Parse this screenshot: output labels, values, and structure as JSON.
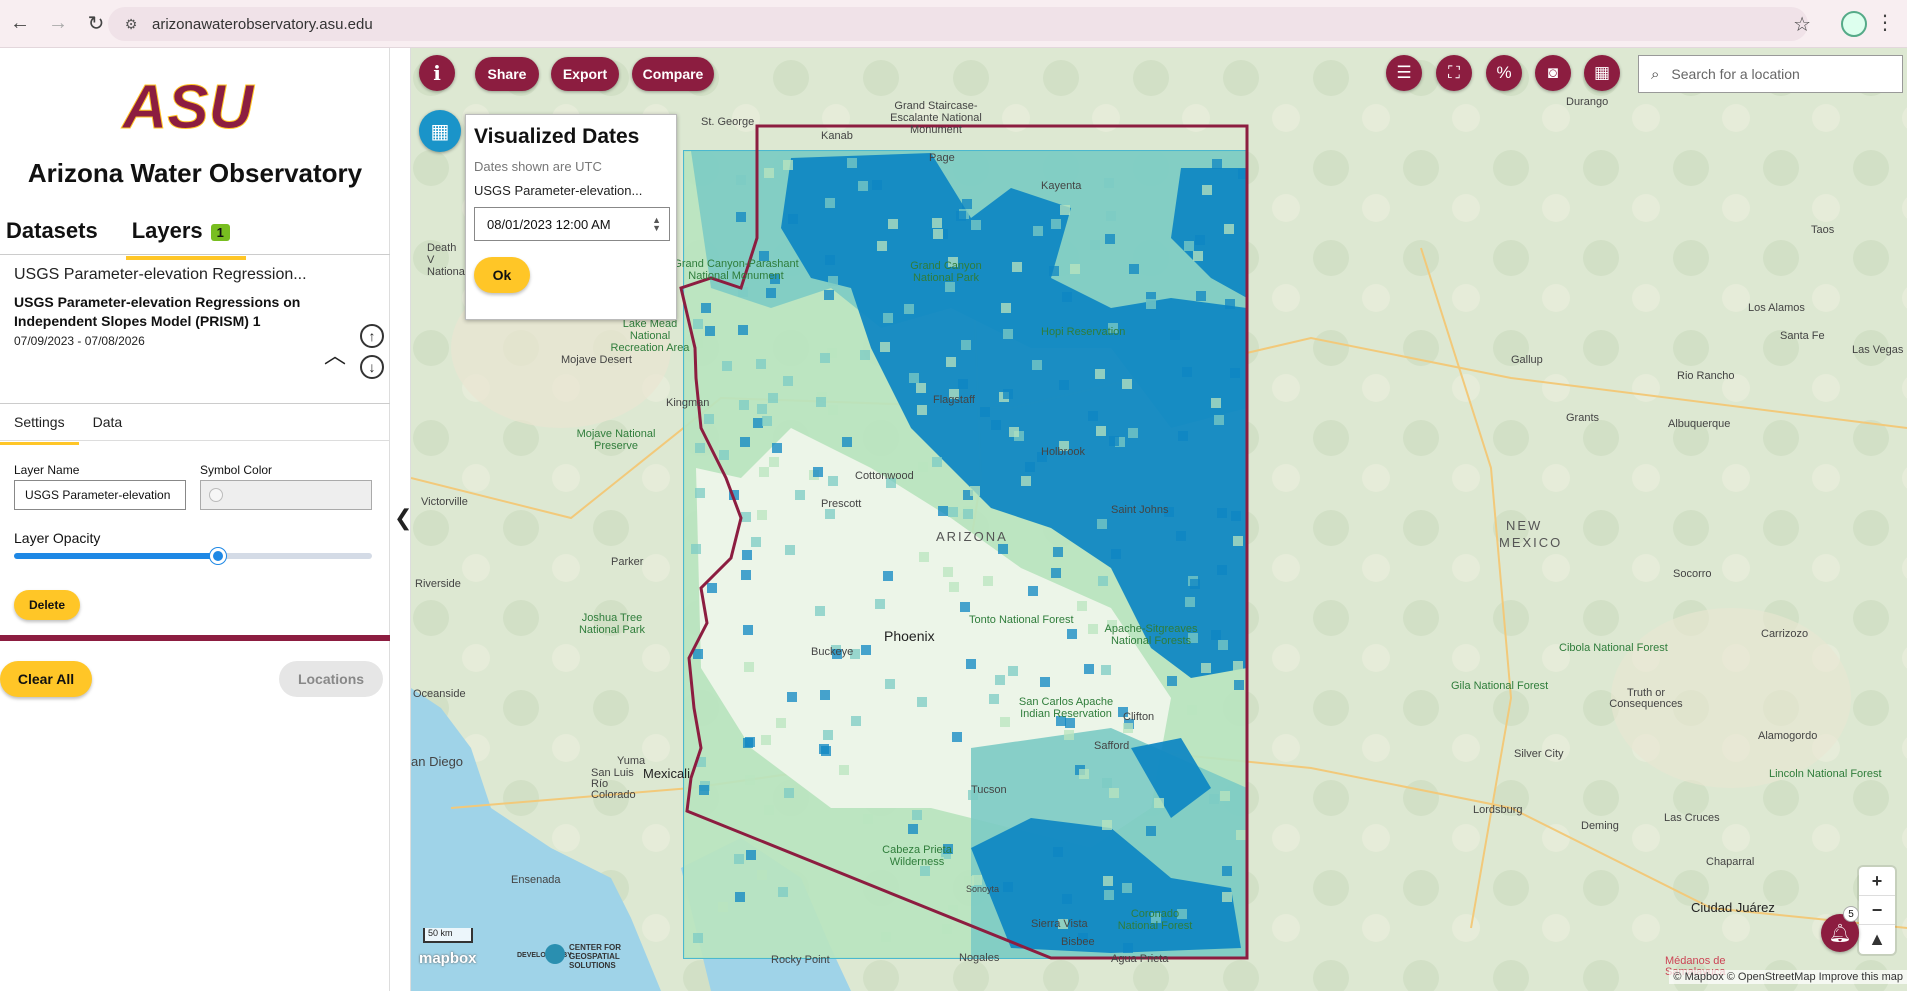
{
  "browser": {
    "url": "arizonawaterobservatory.asu.edu"
  },
  "sidebar": {
    "logo_text": "ASU",
    "app_title": "Arizona Water Observatory",
    "tabs": [
      {
        "label": "Datasets"
      },
      {
        "label": "Layers",
        "badge": "1"
      }
    ],
    "layer": {
      "name_short": "USGS Parameter-elevation Regression...",
      "name_full": "USGS Parameter-elevation Regressions on Independent Slopes Model (PRISM) 1",
      "date_range": "07/09/2023 - 07/08/2026",
      "subtabs": [
        "Settings",
        "Data"
      ],
      "layer_name_label": "Layer Name",
      "layer_name_value": "USGS Parameter-elevation",
      "symbol_color_label": "Symbol Color",
      "opacity_label": "Layer Opacity",
      "opacity_value": 0.57,
      "delete_label": "Delete"
    },
    "clear_all_label": "Clear All",
    "locations_label": "Locations"
  },
  "map_toolbar": {
    "info_label": "i",
    "share_label": "Share",
    "export_label": "Export",
    "compare_label": "Compare",
    "tools": [
      "legend-icon",
      "chart-icon",
      "percent-icon",
      "camera-icon",
      "dashboard-icon"
    ],
    "search_placeholder": "Search for a location"
  },
  "dates_panel": {
    "title": "Visualized Dates",
    "subtitle": "Dates shown are UTC",
    "layer_label": "USGS Parameter-elevation...",
    "selected_date": "08/01/2023 12:00 AM",
    "ok_label": "Ok"
  },
  "map": {
    "labels": {
      "arizona": "ARIZONA",
      "new_mexico_1": "NEW",
      "new_mexico_2": "MEXICO",
      "phoenix": "Phoenix",
      "tucson": "Tucson",
      "flagstaff": "Flagstaff",
      "prescott": "Prescott",
      "kingman": "Kingman",
      "yuma": "Yuma",
      "buckeye": "Buckeye",
      "nogales": "Nogales",
      "mexicali": "Mexicali",
      "san_diego": "an Diego",
      "ciudad_juarez": "Ciudad Juárez",
      "las_cruces": "Las Cruces",
      "albuquerque": "Albuquerque",
      "santa_fe": "Santa Fe",
      "st_george": "St. George",
      "gallup": "Gallup",
      "safford": "Safford",
      "sierra_vista": "Sierra Vista",
      "victorville": "Victorville",
      "riverside": "Riverside",
      "oceanside": "Oceanside",
      "ensenada": "Ensenada",
      "tonto": "Tonto National Forest",
      "grand_canyon": "Grand Canyon National Park",
      "mojave": "Mojave National Preserve",
      "joshua_tree": "Joshua Tree National Park",
      "hopi": "Hopi Reservation",
      "san_carlos": "San Carlos Apache Indian Reservation",
      "cabeza": "Cabeza Prieta Wilderness",
      "coronado": "Coronado National Forest",
      "gila": "Gila National Forest",
      "cibola": "Cibola National Forest",
      "lincoln": "Lincoln National Forest",
      "apache": "Apache-Sitgreaves National Forests",
      "lake_mead": "Lake Mead National Recreation Area",
      "parashant": "Grand Canyon-Parashant National Monument",
      "kayenta": "Kayenta",
      "page": "Page",
      "holbrook": "Holbrook",
      "parker": "Parker",
      "rocky_point": "Rocky Point",
      "san_luis": "San Luis Río Colorado",
      "durango": "Durango",
      "taos": "Taos",
      "los_alamos": "Los Alamos",
      "las_vegas_nm": "Las Vegas",
      "rio_rancho": "Rio Rancho",
      "grants": "Grants",
      "socorro": "Socorro",
      "silver_city": "Silver City",
      "deming": "Deming",
      "lordsburg": "Lordsburg",
      "alamogordo": "Alamogordo",
      "truth_or_consequences": "Truth or Consequences",
      "carrizozo": "Carrizozo",
      "chaparral": "Chaparral",
      "mojave_desert": "Mojave Desert",
      "bisbee": "Bisbee",
      "sonoyta": "Sonoyta",
      "agua_prieta": "Agua Prieta",
      "kanab": "Kanab",
      "escalante": "Grand Staircase-Escalante National Monument",
      "death_valley": "Death V Nationa",
      "clifton": "Clifton",
      "saint_johns": "Saint Johns",
      "cottonwood": "Cottonwood",
      "medanos": "Médanos de Samalayuca"
    },
    "scale_label": "50 km",
    "mapbox_label": "mapbox",
    "developed_by": "DEVELOPED BY",
    "cgs": "CENTER FOR GEOSPATIAL SOLUTIONS",
    "attribution": "© Mapbox © OpenStreetMap  Improve this map",
    "notification_count": "5",
    "colors": {
      "high": "#0e86c3",
      "mid": "#7ccbc4",
      "low": "#b9e4bf",
      "lowest": "#eef6ea",
      "border": "#8c1d40"
    }
  }
}
